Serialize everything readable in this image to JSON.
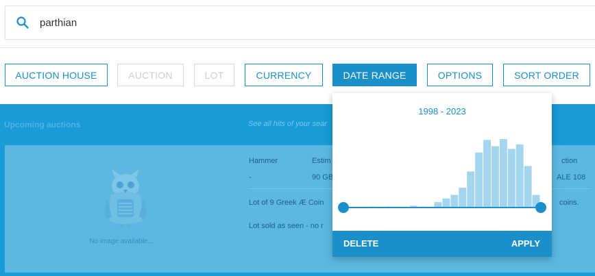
{
  "search": {
    "value": "parthian",
    "icon": "search-icon"
  },
  "filters": [
    {
      "label": "AUCTION HOUSE",
      "state": "enabled"
    },
    {
      "label": "AUCTION",
      "state": "disabled"
    },
    {
      "label": "LOT",
      "state": "disabled"
    },
    {
      "label": "CURRENCY",
      "state": "enabled"
    },
    {
      "label": "DATE RANGE",
      "state": "active"
    },
    {
      "label": "OPTIONS",
      "state": "enabled"
    },
    {
      "label": "SORT ORDER",
      "state": "enabled"
    }
  ],
  "results": {
    "section_title": "Upcoming auctions",
    "see_all_link": "See all hits of your sear",
    "card": {
      "no_image_text": "No image available...",
      "columns": {
        "hammer_label": "Hammer",
        "hammer_value": "-",
        "estimate_label": "Estim",
        "estimate_value": "90 GB",
        "auction_label": "ction",
        "auction_value": "ALE 108"
      },
      "description": "Lot of 9 Greek Æ Coin",
      "description_tail": "coins.",
      "note": "Lot sold as seen - no r"
    }
  },
  "date_popup": {
    "range_text": "1998 - 2023",
    "range_start": 1998,
    "range_end": 2023,
    "histogram_counts": [
      0,
      0,
      0,
      1,
      0,
      1,
      1,
      0,
      2,
      1,
      0,
      6,
      10,
      14,
      22,
      40,
      61,
      75,
      68,
      76,
      65,
      70,
      46,
      14
    ],
    "delete_label": "DELETE",
    "apply_label": "APPLY"
  },
  "colors": {
    "accent": "#1a8fc9",
    "results_bg": "#189bd7",
    "card_bg": "#5cb8e1",
    "histogram_bar": "#a3d5ef"
  }
}
